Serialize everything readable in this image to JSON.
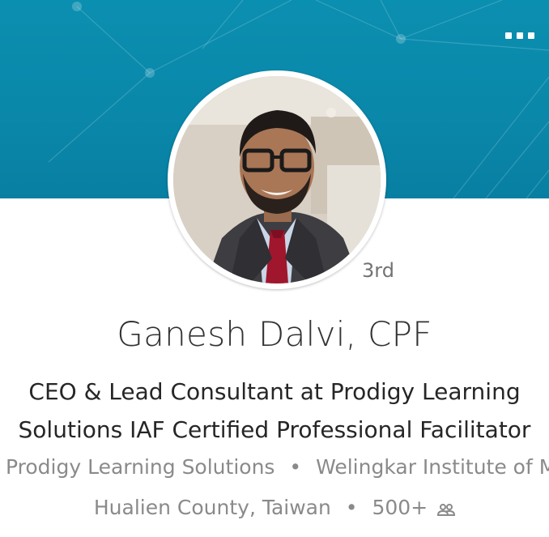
{
  "profile": {
    "name": "Ganesh Dalvi, CPF",
    "degree": "3rd",
    "headline_line1": "CEO & Lead Consultant at Prodigy Learning",
    "headline_line2": "Solutions IAF Certified Professional Facilitator",
    "company_current": "Prodigy Learning Solutions",
    "school": "Welingkar Institute of Ma",
    "location": "Hualien County, Taiwan",
    "connections": "500+"
  },
  "separator": "•",
  "icons": {
    "more": "more-dots-icon",
    "connections": "people-icon"
  },
  "colors": {
    "banner": "#0a87a9",
    "text_primary": "#262626",
    "text_secondary": "#8a8a8a",
    "name": "#333333"
  }
}
